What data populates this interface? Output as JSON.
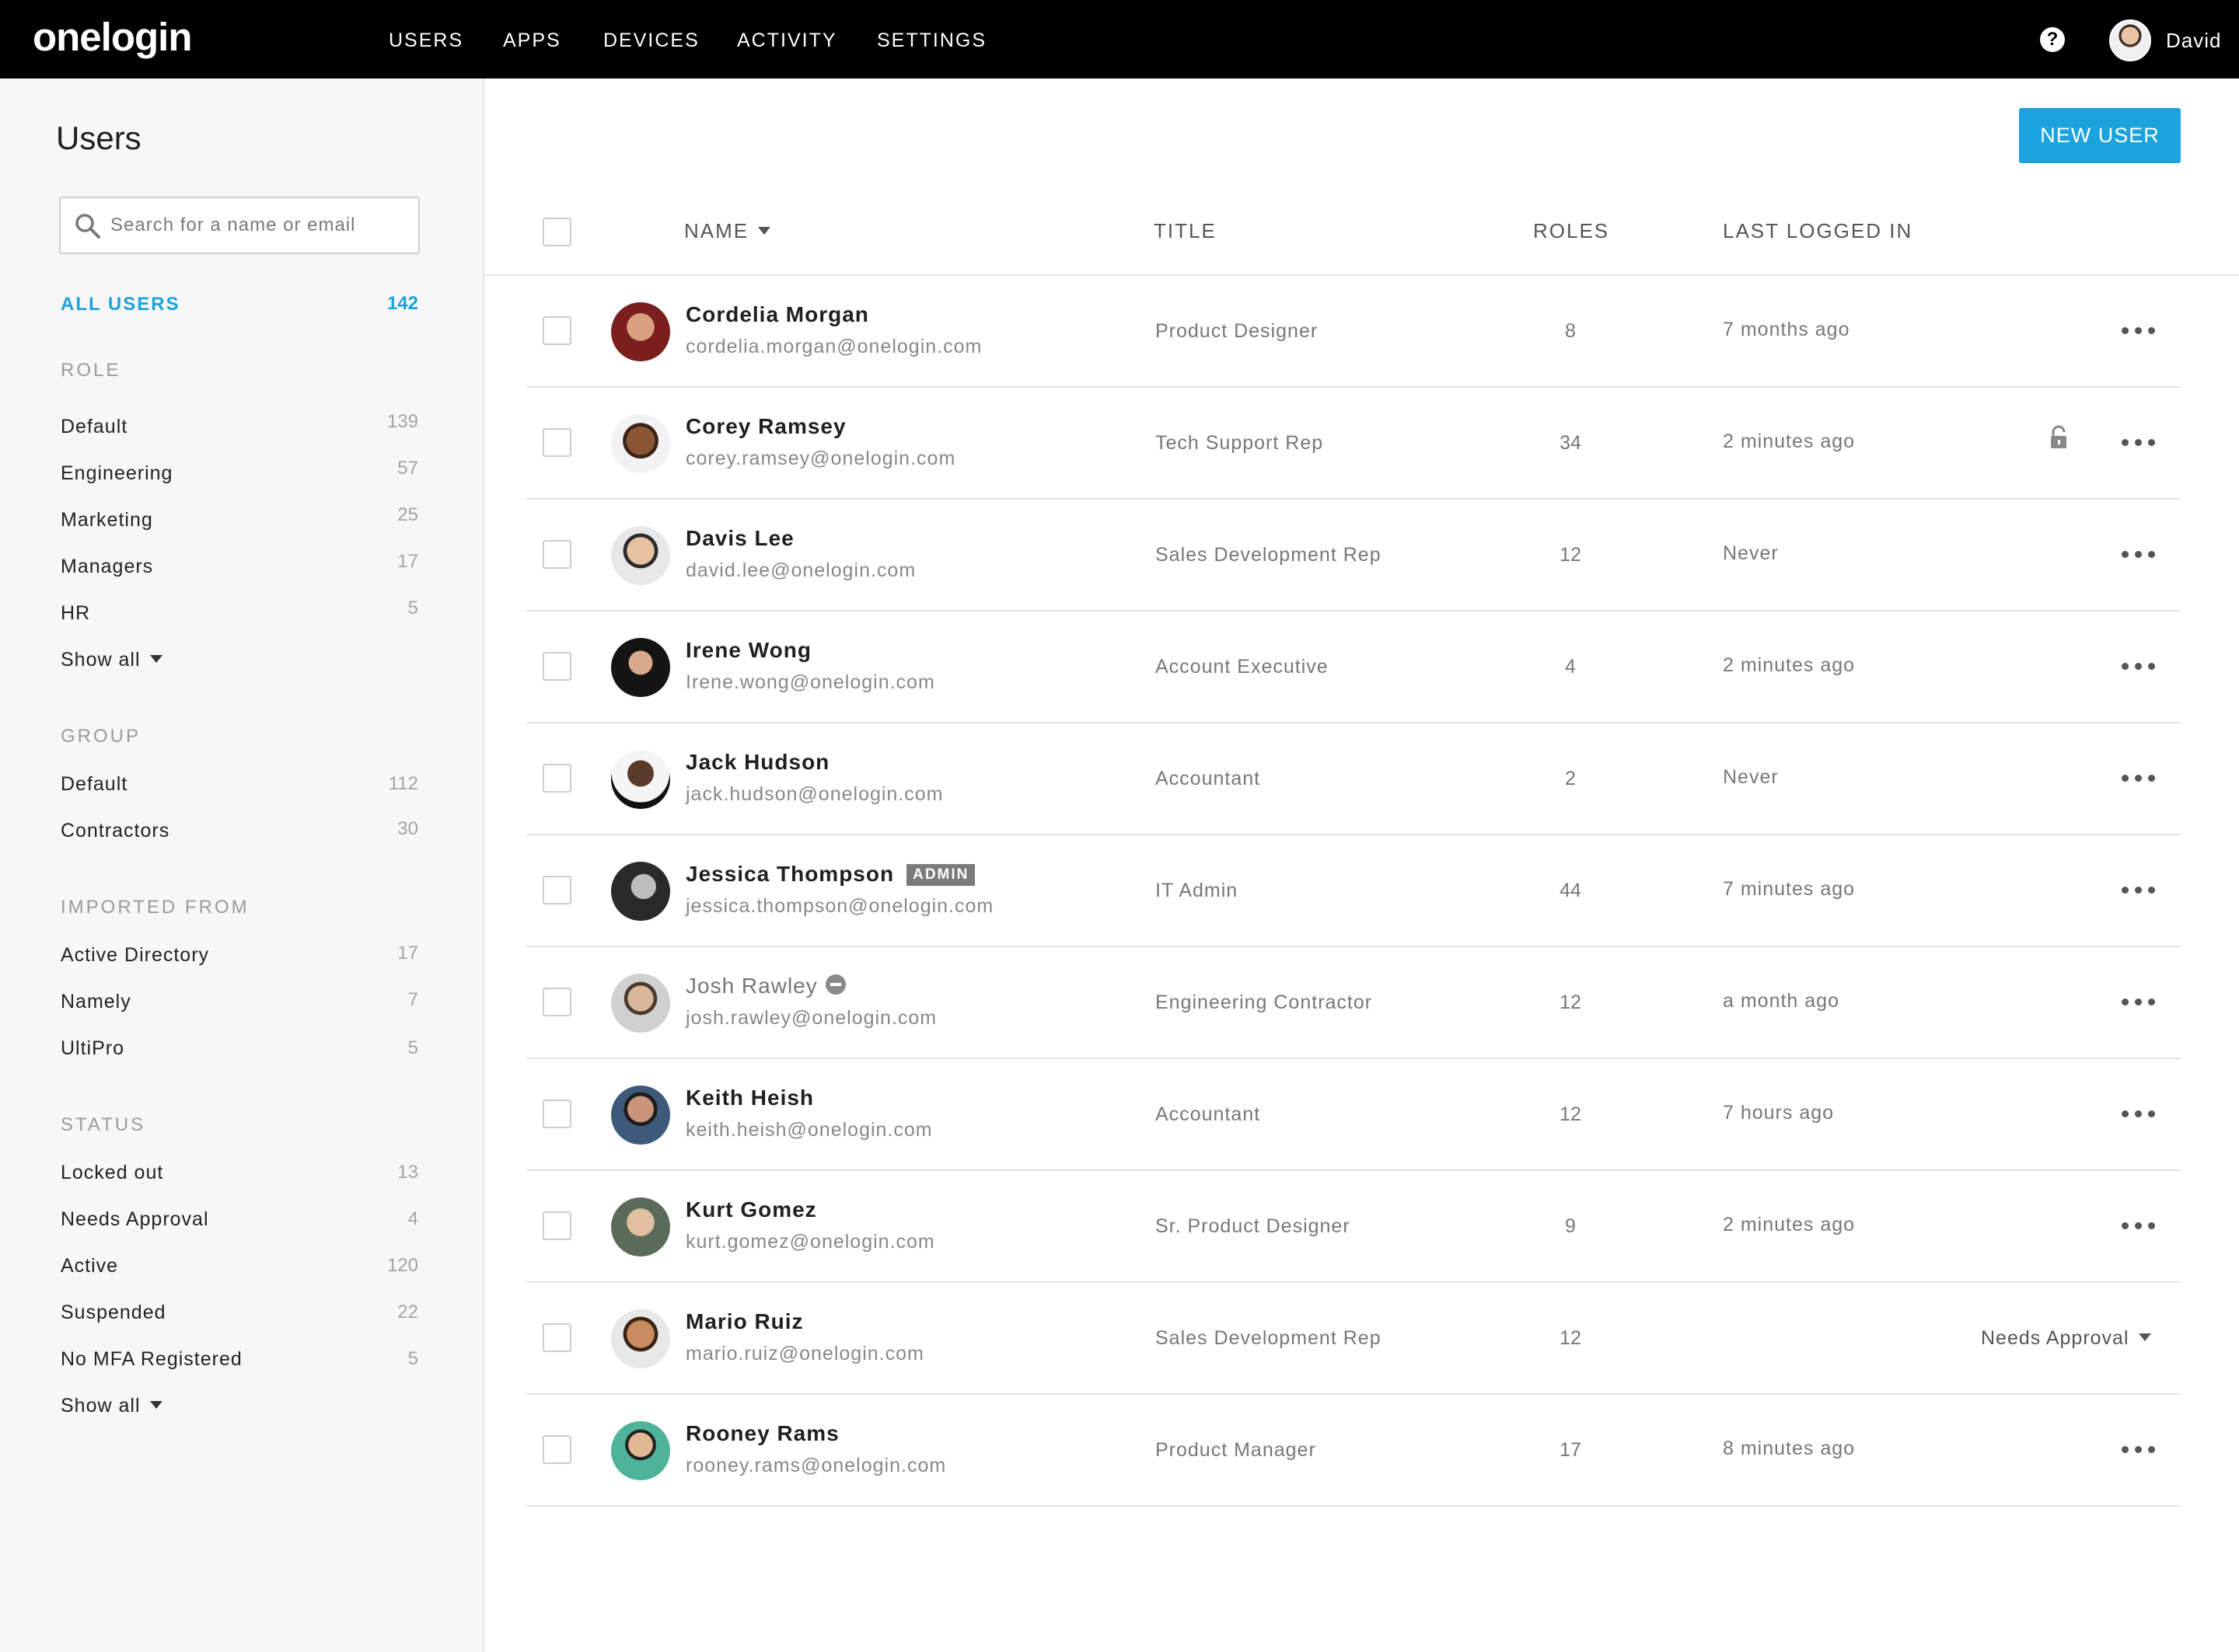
{
  "app": {
    "logo_text": "onelogin",
    "nav": [
      "USERS",
      "APPS",
      "DEVICES",
      "ACTIVITY",
      "SETTINGS"
    ],
    "help_glyph": "?",
    "current_user": "David"
  },
  "sidebar": {
    "title": "Users",
    "search_placeholder": "Search for a name or email",
    "all_users": {
      "label": "ALL USERS",
      "count": "142"
    },
    "role": {
      "heading": "ROLE",
      "items": [
        {
          "label": "Default",
          "count": "139"
        },
        {
          "label": "Engineering",
          "count": "57"
        },
        {
          "label": "Marketing",
          "count": "25"
        },
        {
          "label": "Managers",
          "count": "17"
        },
        {
          "label": "HR",
          "count": "5"
        }
      ],
      "show_all": "Show all"
    },
    "group": {
      "heading": "GROUP",
      "items": [
        {
          "label": "Default",
          "count": "112"
        },
        {
          "label": "Contractors",
          "count": "30"
        }
      ]
    },
    "imported": {
      "heading": "IMPORTED FROM",
      "items": [
        {
          "label": "Active Directory",
          "count": "17"
        },
        {
          "label": "Namely",
          "count": "7"
        },
        {
          "label": "UltiPro",
          "count": "5"
        }
      ]
    },
    "status": {
      "heading": "STATUS",
      "items": [
        {
          "label": "Locked out",
          "count": "13"
        },
        {
          "label": "Needs Approval",
          "count": "4"
        },
        {
          "label": "Active",
          "count": "120"
        },
        {
          "label": "Suspended",
          "count": "22"
        },
        {
          "label": "No MFA Registered",
          "count": "5"
        }
      ],
      "show_all": "Show all"
    }
  },
  "main": {
    "new_user_label": "NEW USER",
    "columns": {
      "name": "NAME",
      "title": "TITLE",
      "roles": "ROLES",
      "last": "LAST LOGGED IN"
    },
    "users": [
      {
        "name": "Cordelia Morgan",
        "email": "cordelia.morgan@onelogin.com",
        "title": "Product Designer",
        "roles": "8",
        "last": "7 months ago"
      },
      {
        "name": "Corey Ramsey",
        "email": "corey.ramsey@onelogin.com",
        "title": "Tech Support Rep",
        "roles": "34",
        "last": "2 minutes ago",
        "locked": true
      },
      {
        "name": "Davis Lee",
        "email": "david.lee@onelogin.com",
        "title": "Sales Development Rep",
        "roles": "12",
        "last": "Never"
      },
      {
        "name": "Irene Wong",
        "email": "Irene.wong@onelogin.com",
        "title": "Account Executive",
        "roles": "4",
        "last": "2 minutes ago"
      },
      {
        "name": "Jack Hudson",
        "email": "jack.hudson@onelogin.com",
        "title": "Accountant",
        "roles": "2",
        "last": "Never"
      },
      {
        "name": "Jessica Thompson",
        "email": "jessica.thompson@onelogin.com",
        "title": "IT Admin",
        "roles": "44",
        "last": "7 minutes ago",
        "badge": "ADMIN"
      },
      {
        "name": "Josh Rawley",
        "email": "josh.rawley@onelogin.com",
        "title": "Engineering Contractor",
        "roles": "12",
        "last": "a month ago",
        "suspended": true
      },
      {
        "name": "Keith Heish",
        "email": "keith.heish@onelogin.com",
        "title": "Accountant",
        "roles": "12",
        "last": "7 hours ago"
      },
      {
        "name": "Kurt Gomez",
        "email": "kurt.gomez@onelogin.com",
        "title": "Sr. Product Designer",
        "roles": "9",
        "last": "2 minutes ago"
      },
      {
        "name": "Mario Ruiz",
        "email": "mario.ruiz@onelogin.com",
        "title": "Sales Development Rep",
        "roles": "12",
        "last": "",
        "action": "Needs Approval"
      },
      {
        "name": "Rooney Rams",
        "email": "rooney.rams@onelogin.com",
        "title": "Product Manager",
        "roles": "17",
        "last": "8 minutes ago"
      }
    ]
  },
  "colors": {
    "accent": "#1aa3dc",
    "topbar": "#000000",
    "sidebar_bg": "#f7f7f7"
  }
}
